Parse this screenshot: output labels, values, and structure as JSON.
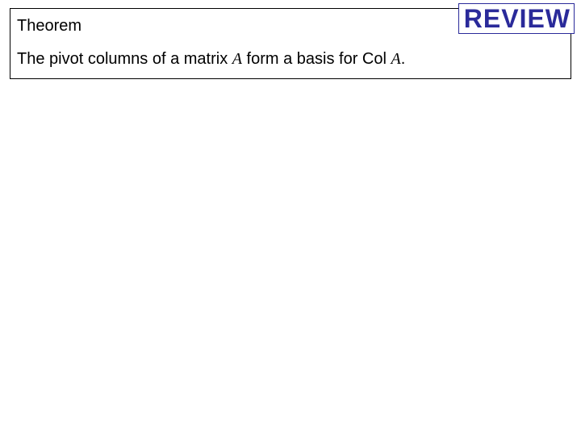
{
  "theorem": {
    "title": "Theorem",
    "body_part1": "The pivot columns of a matrix ",
    "body_mathA1": "A",
    "body_part2": " form a basis for Col ",
    "body_mathA2": "A",
    "body_part3": "."
  },
  "review": {
    "label": "REVIEW"
  }
}
